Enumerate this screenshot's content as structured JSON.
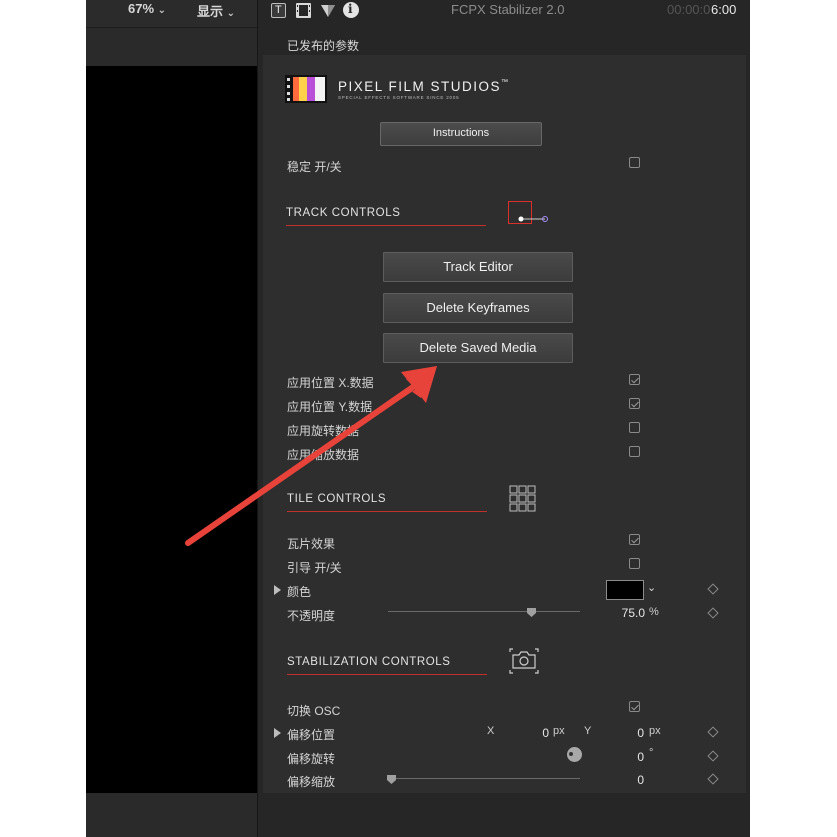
{
  "viewer": {
    "zoom": "67%",
    "display_menu": "显示"
  },
  "inspector": {
    "title": "FCPX Stabilizer 2.0",
    "timecode_dim": "00:00:0",
    "timecode": "6:00",
    "published_params": "已发布的参数",
    "logo": {
      "brand": "PIXEL FILM STUDIOS",
      "trademark": "™",
      "tagline": "SPECIAL EFFECTS SOFTWARE SINCE 2005"
    },
    "instructions_label": "Instructions",
    "stabilize_toggle": {
      "label": "稳定 开/关",
      "checked": false
    },
    "track_controls": {
      "title": "TRACK CONTROLS",
      "buttons": [
        "Track Editor",
        "Delete Keyframes",
        "Delete Saved Media"
      ],
      "options": [
        {
          "label": "应用位置 X.数据",
          "checked": true
        },
        {
          "label": "应用位置 Y.数据",
          "checked": true
        },
        {
          "label": "应用旋转数据",
          "checked": false
        },
        {
          "label": "应用缩放数据",
          "checked": false
        }
      ]
    },
    "tile_controls": {
      "title": "TILE CONTROLS",
      "tile_effect": {
        "label": "瓦片效果",
        "checked": true
      },
      "guide_toggle": {
        "label": "引导 开/关",
        "checked": false
      },
      "color_label": "颜色",
      "color_value": "#000000",
      "opacity_label": "不透明度",
      "opacity_value": "75.0",
      "opacity_unit": "%",
      "opacity_fraction": 0.75
    },
    "stabilization_controls": {
      "title": "STABILIZATION CONTROLS",
      "switch_osc": {
        "label": "切换 OSC",
        "checked": true
      },
      "offset_position": {
        "label": "偏移位置",
        "x_label": "X",
        "x_value": "0",
        "x_unit": "px",
        "y_label": "Y",
        "y_value": "0",
        "y_unit": "px"
      },
      "offset_rotation": {
        "label": "偏移旋转",
        "value": "0",
        "unit": "°"
      },
      "offset_scale": {
        "label": "偏移缩放",
        "value": "0",
        "fraction": 0.0
      }
    }
  },
  "colors": {
    "accent_red": "#c0312b",
    "arrow_red": "#e8433a",
    "panel_bg": "#2e2e2e"
  }
}
